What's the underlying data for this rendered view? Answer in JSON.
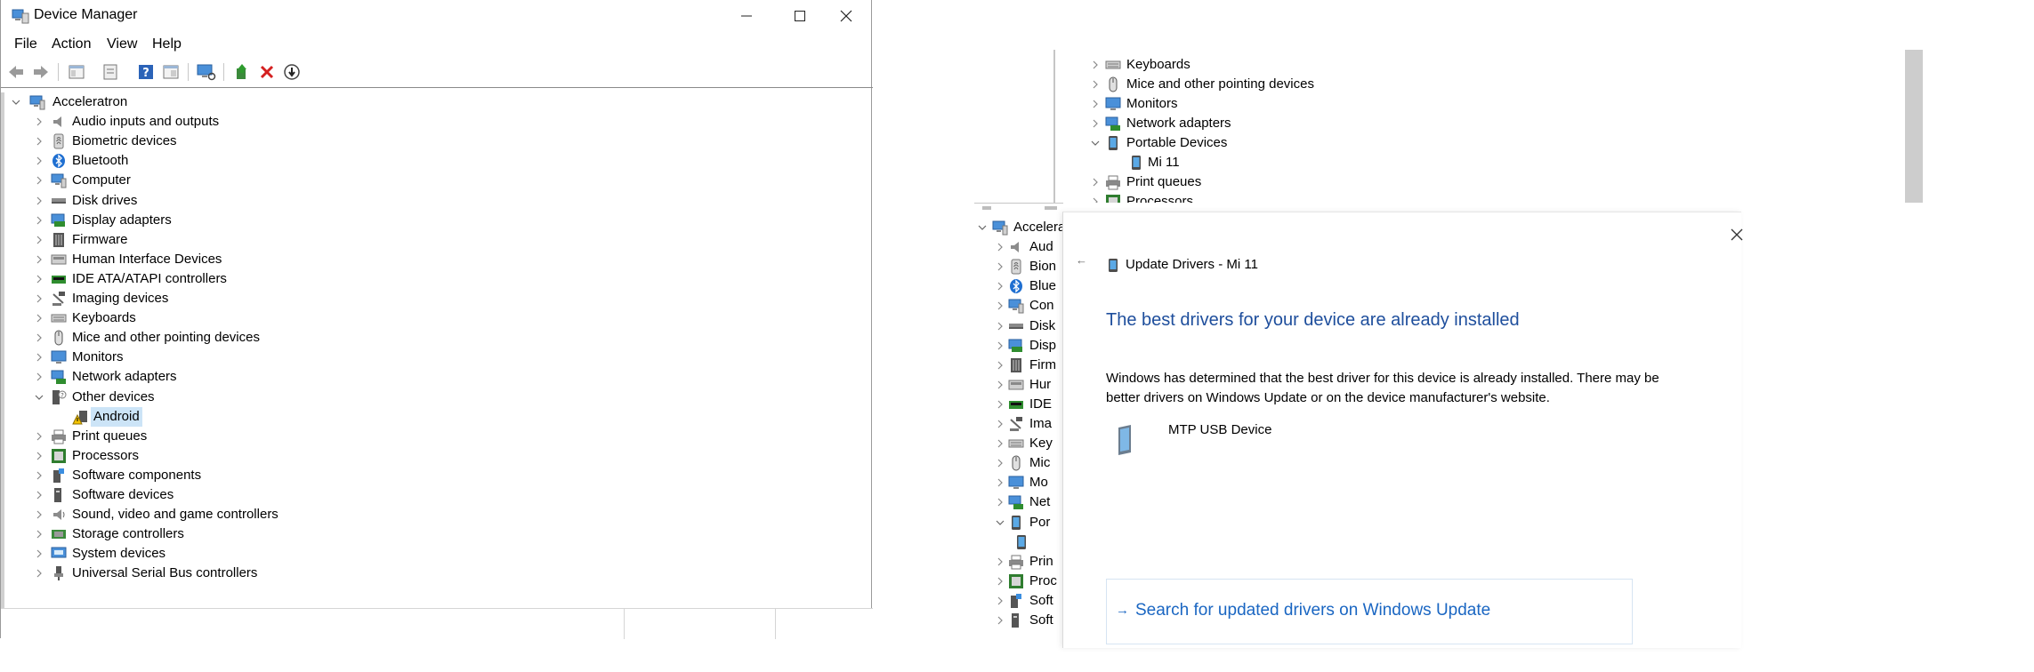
{
  "window": {
    "title": "Device Manager",
    "controls": {
      "minimize": "—",
      "maximize": "□",
      "close": "✕"
    }
  },
  "menu": [
    "File",
    "Action",
    "View",
    "Help"
  ],
  "toolbar": {
    "icons": [
      "back-arrow-icon",
      "forward-arrow-icon",
      "show-hide-console-tree-icon",
      "properties-icon",
      "help-icon",
      "view-icon",
      "scan-hardware-icon",
      "update-driver-icon",
      "uninstall-device-icon",
      "disable-device-icon"
    ]
  },
  "tree": {
    "root": "Acceleratron",
    "categories": [
      {
        "label": "Audio inputs and outputs",
        "icon": "speaker-icon"
      },
      {
        "label": "Biometric devices",
        "icon": "fingerprint-icon"
      },
      {
        "label": "Bluetooth",
        "icon": "bluetooth-icon"
      },
      {
        "label": "Computer",
        "icon": "computer-icon"
      },
      {
        "label": "Disk drives",
        "icon": "disk-drive-icon"
      },
      {
        "label": "Display adapters",
        "icon": "display-adapter-icon"
      },
      {
        "label": "Firmware",
        "icon": "firmware-icon"
      },
      {
        "label": "Human Interface Devices",
        "icon": "hid-icon"
      },
      {
        "label": "IDE ATA/ATAPI controllers",
        "icon": "ide-icon"
      },
      {
        "label": "Imaging devices",
        "icon": "camera-icon"
      },
      {
        "label": "Keyboards",
        "icon": "keyboard-icon"
      },
      {
        "label": "Mice and other pointing devices",
        "icon": "mouse-icon"
      },
      {
        "label": "Monitors",
        "icon": "monitor-icon"
      },
      {
        "label": "Network adapters",
        "icon": "network-adapter-icon"
      },
      {
        "label": "Other devices",
        "icon": "unknown-device-icon",
        "expanded": true,
        "children": [
          {
            "label": "Android",
            "icon": "warning-device-icon",
            "selected": true
          }
        ]
      },
      {
        "label": "Print queues",
        "icon": "printer-icon"
      },
      {
        "label": "Processors",
        "icon": "processor-icon"
      },
      {
        "label": "Software components",
        "icon": "software-component-icon"
      },
      {
        "label": "Software devices",
        "icon": "software-device-icon"
      },
      {
        "label": "Sound, video and game controllers",
        "icon": "sound-icon"
      },
      {
        "label": "Storage controllers",
        "icon": "storage-controller-icon"
      },
      {
        "label": "System devices",
        "icon": "system-device-icon"
      },
      {
        "label": "Universal Serial Bus controllers",
        "icon": "usb-icon"
      }
    ]
  },
  "bg_top_tree": [
    {
      "label": "Keyboards",
      "icon": "keyboard-icon"
    },
    {
      "label": "Mice and other pointing devices",
      "icon": "mouse-icon"
    },
    {
      "label": "Monitors",
      "icon": "monitor-icon"
    },
    {
      "label": "Network adapters",
      "icon": "network-adapter-icon"
    },
    {
      "label": "Portable Devices",
      "icon": "portable-device-icon",
      "expanded": true
    },
    {
      "label": "Mi 11",
      "icon": "phone-icon",
      "child": true
    },
    {
      "label": "Print queues",
      "icon": "printer-icon"
    },
    {
      "label": "Processors",
      "icon": "processor-icon"
    }
  ],
  "bg_bottom_tree": [
    {
      "label": "Accelera",
      "root": true,
      "icon": "computer-icon"
    },
    {
      "label": "Aud",
      "icon": "speaker-icon"
    },
    {
      "label": "Bion",
      "icon": "fingerprint-icon"
    },
    {
      "label": "Blue",
      "icon": "bluetooth-icon"
    },
    {
      "label": "Con",
      "icon": "computer-icon"
    },
    {
      "label": "Disk",
      "icon": "disk-drive-icon"
    },
    {
      "label": "Disp",
      "icon": "display-adapter-icon"
    },
    {
      "label": "Firm",
      "icon": "firmware-icon"
    },
    {
      "label": "Hur",
      "icon": "hid-icon"
    },
    {
      "label": "IDE",
      "icon": "ide-icon"
    },
    {
      "label": "Ima",
      "icon": "camera-icon"
    },
    {
      "label": "Key",
      "icon": "keyboard-icon"
    },
    {
      "label": "Mic",
      "icon": "mouse-icon"
    },
    {
      "label": "Mo",
      "icon": "monitor-icon"
    },
    {
      "label": "Net",
      "icon": "network-adapter-icon"
    },
    {
      "label": "Por",
      "icon": "portable-device-icon",
      "expanded": true
    },
    {
      "label": "",
      "icon": "phone-icon",
      "child": true
    },
    {
      "label": "Prin",
      "icon": "printer-icon"
    },
    {
      "label": "Proc",
      "icon": "processor-icon"
    },
    {
      "label": "Soft",
      "icon": "software-component-icon"
    },
    {
      "label": "Soft",
      "icon": "software-device-icon"
    }
  ],
  "dialog": {
    "title": "Update Drivers - Mi 11",
    "heading": "The best drivers for your device are already installed",
    "description": "Windows has determined that the best driver for this device is already installed. There may be better drivers on Windows Update or on the device manufacturer's website.",
    "device_name": "MTP USB Device",
    "link_text": "Search for updated drivers on Windows Update",
    "back_glyph": "←",
    "close_glyph": "✕",
    "link_arrow": "→"
  },
  "colors": {
    "heading_blue": "#1e4e9c",
    "link_blue": "#1a66c2",
    "selection": "#cce4f7"
  }
}
